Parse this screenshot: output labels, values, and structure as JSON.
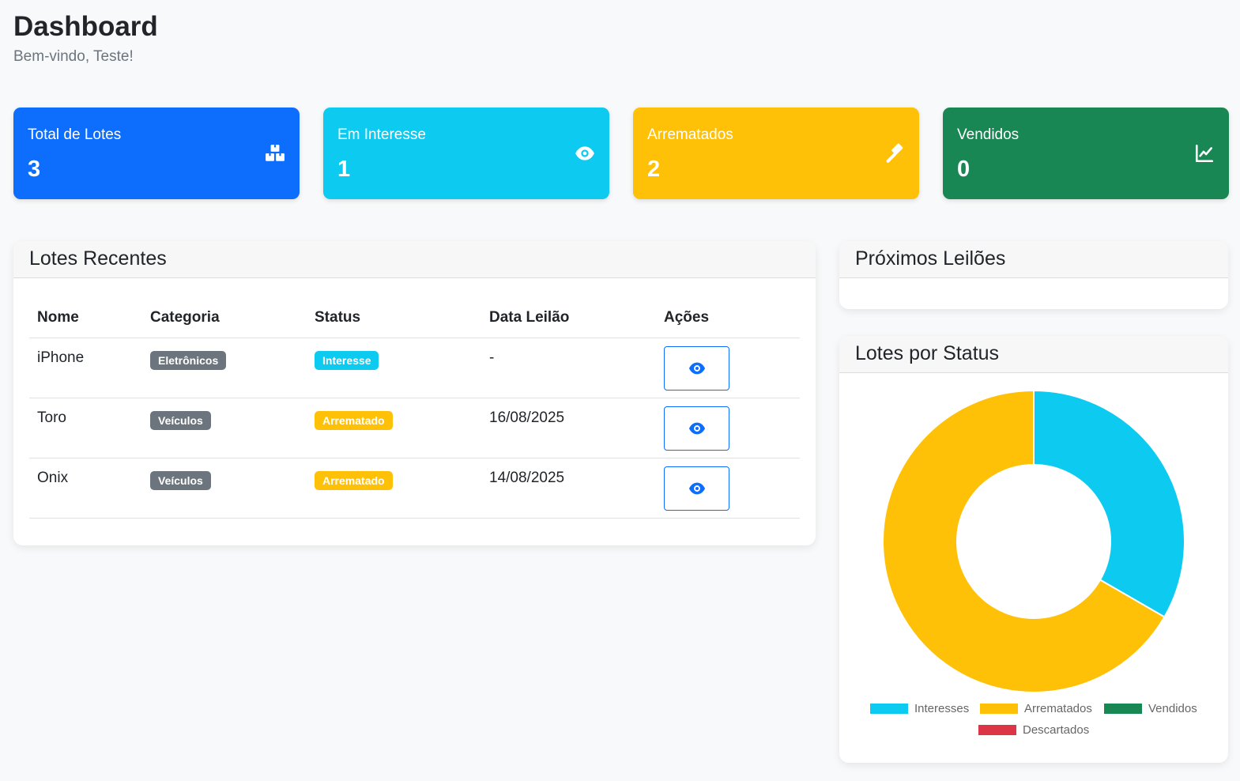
{
  "header": {
    "title": "Dashboard",
    "subtitle": "Bem-vindo, Teste!"
  },
  "stats": [
    {
      "label": "Total de Lotes",
      "value": "3",
      "color": "#0d6efd",
      "icon": "boxes-icon"
    },
    {
      "label": "Em Interesse",
      "value": "1",
      "color": "#0dcaf0",
      "icon": "eye-icon"
    },
    {
      "label": "Arrematados",
      "value": "2",
      "color": "#ffc107",
      "icon": "gavel-icon"
    },
    {
      "label": "Vendidos",
      "value": "0",
      "color": "#198754",
      "icon": "chart-line-icon"
    }
  ],
  "recent": {
    "title": "Lotes Recentes",
    "columns": [
      "Nome",
      "Categoria",
      "Status",
      "Data Leilão",
      "Ações"
    ],
    "rows": [
      {
        "nome": "iPhone",
        "categoria": "Eletrônicos",
        "status": "Interesse",
        "data": "-"
      },
      {
        "nome": "Toro",
        "categoria": "Veículos",
        "status": "Arrematado",
        "data": "16/08/2025"
      },
      {
        "nome": "Onix",
        "categoria": "Veículos",
        "status": "Arrematado",
        "data": "14/08/2025"
      }
    ]
  },
  "upcoming": {
    "title": "Próximos Leilões"
  },
  "status_chart": {
    "title": "Lotes por Status",
    "legend": [
      "Interesses",
      "Arrematados",
      "Vendidos",
      "Descartados"
    ]
  },
  "chart_data": {
    "type": "pie",
    "categories": [
      "Interesses",
      "Arrematados",
      "Vendidos",
      "Descartados"
    ],
    "values": [
      1,
      2,
      0,
      0
    ],
    "colors": [
      "#0dcaf0",
      "#ffc107",
      "#198754",
      "#dc3545"
    ],
    "title": "Lotes por Status",
    "legend_position": "bottom"
  }
}
